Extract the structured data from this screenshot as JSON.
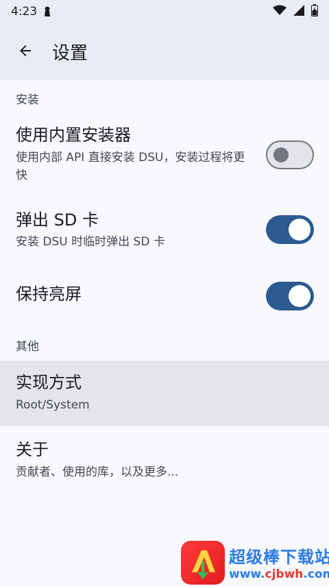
{
  "status_bar": {
    "time": "4:23",
    "icons": [
      "lock-icon",
      "wifi-icon",
      "signal-icon",
      "battery-icon"
    ]
  },
  "app_bar": {
    "title": "设置",
    "back_icon": "arrow-back-icon"
  },
  "sections": {
    "install": {
      "header": "安装",
      "items": [
        {
          "title": "使用内置安装器",
          "summary": "使用内部 API 直接安装 DSU，安装过程将更快",
          "switch_on": false
        },
        {
          "title": "弹出 SD 卡",
          "summary": "安装 DSU 时临时弹出 SD 卡",
          "switch_on": true
        },
        {
          "title": "保持亮屏",
          "switch_on": true
        }
      ]
    },
    "other": {
      "header": "其他",
      "items": [
        {
          "title": "实现方式",
          "summary": "Root/System"
        },
        {
          "title": "关于",
          "summary": "贡献者、使用的库，以及更多..."
        }
      ]
    }
  },
  "colors": {
    "accent": "#2b5b91",
    "app_bar_bg": "#e9ecf3",
    "background": "#f8f9fd",
    "watermark_blue": "#2c7be5",
    "watermark_red": "#e83a2f"
  },
  "watermark": {
    "text_cn": "超级棒下载站",
    "url_prefix": "www.",
    "url_main": "cjbwh",
    "url_suffix": ".com"
  }
}
